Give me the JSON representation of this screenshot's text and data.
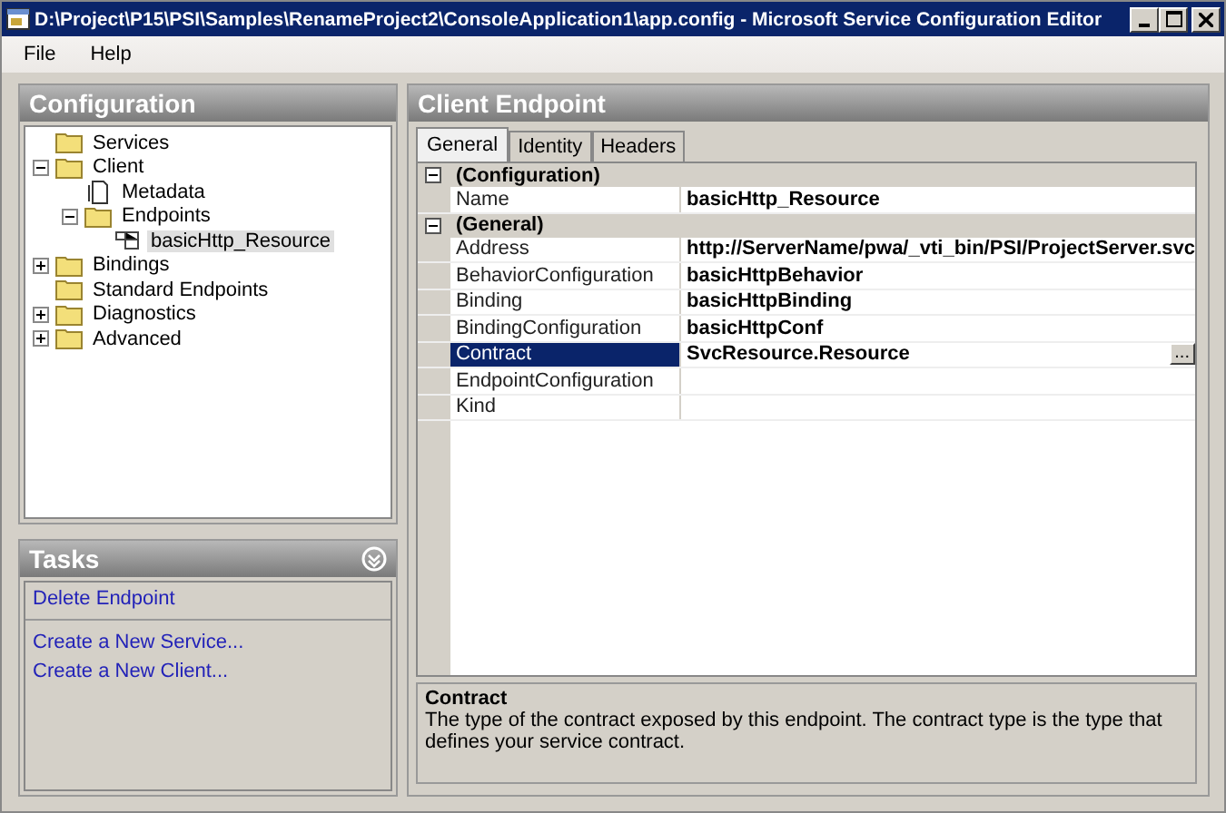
{
  "window": {
    "title": "D:\\Project\\P15\\PSI\\Samples\\RenameProject2\\ConsoleApplication1\\app.config - Microsoft Service Configuration Editor"
  },
  "menu": [
    "File",
    "Help"
  ],
  "configuration": {
    "title": "Configuration",
    "tree": [
      {
        "label": "Services",
        "kind": "folder",
        "selected": false
      },
      {
        "label": "Client",
        "kind": "folder",
        "selected": false,
        "expanded": true,
        "children": [
          {
            "label": "Metadata",
            "kind": "document",
            "selected": false
          },
          {
            "label": "Endpoints",
            "kind": "folder",
            "selected": false,
            "expanded": true,
            "children": [
              {
                "label": "basicHttp_Resource",
                "kind": "endpoint",
                "selected": true
              }
            ]
          }
        ]
      },
      {
        "label": "Bindings",
        "kind": "folder",
        "selected": false,
        "expanded": false
      },
      {
        "label": "Standard Endpoints",
        "kind": "folder",
        "selected": false
      },
      {
        "label": "Diagnostics",
        "kind": "folder",
        "selected": false,
        "expanded": false
      },
      {
        "label": "Advanced",
        "kind": "folder",
        "selected": false,
        "expanded": false
      }
    ]
  },
  "tasks": {
    "title": "Tasks",
    "groups": [
      [
        "Delete Endpoint"
      ],
      [
        "Create a New Service...",
        "Create a New Client..."
      ]
    ]
  },
  "endpoint": {
    "title": "Client Endpoint",
    "tabs": [
      {
        "label": "General",
        "selected": true
      },
      {
        "label": "Identity",
        "selected": false
      },
      {
        "label": "Headers",
        "selected": false
      }
    ],
    "categories": [
      {
        "name": "(Configuration)",
        "expanded": true,
        "rows": [
          {
            "name": "Name",
            "value": "basicHttp_Resource",
            "selected": false
          }
        ]
      },
      {
        "name": "(General)",
        "expanded": true,
        "rows": [
          {
            "name": "Address",
            "value": "http://ServerName/pwa/_vti_bin/PSI/ProjectServer.svc",
            "selected": false
          },
          {
            "name": "BehaviorConfiguration",
            "value": "basicHttpBehavior",
            "selected": false
          },
          {
            "name": "Binding",
            "value": "basicHttpBinding",
            "selected": false
          },
          {
            "name": "BindingConfiguration",
            "value": "basicHttpConf",
            "selected": false
          },
          {
            "name": "Contract",
            "value": "SvcResource.Resource",
            "selected": true,
            "button": "..."
          },
          {
            "name": "EndpointConfiguration",
            "selected": false
          },
          {
            "name": "Kind",
            "selected": false
          }
        ]
      }
    ],
    "description": {
      "title": "Contract",
      "text": "The type of the contract exposed by this endpoint. The contract type is the type that defines your service contract."
    }
  }
}
